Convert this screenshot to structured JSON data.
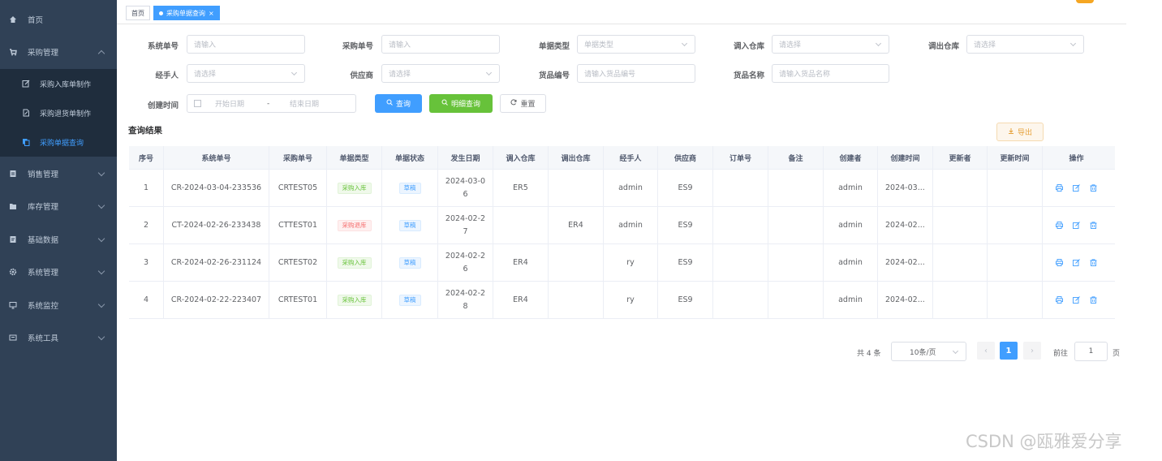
{
  "sidebar": {
    "items": [
      {
        "label": "首页",
        "icon": "dashboard-icon"
      },
      {
        "label": "采购管理",
        "icon": "cart-icon"
      },
      {
        "label": "销售管理",
        "icon": "document-icon"
      },
      {
        "label": "库存管理",
        "icon": "folder-icon"
      },
      {
        "label": "基础数据",
        "icon": "document-icon"
      },
      {
        "label": "系统管理",
        "icon": "gear-icon"
      },
      {
        "label": "系统监控",
        "icon": "monitor-icon"
      },
      {
        "label": "系统工具",
        "icon": "tool-icon"
      }
    ],
    "subitems": [
      {
        "label": "采购入库单制作",
        "icon": "edit-icon"
      },
      {
        "label": "采购退货单制作",
        "icon": "edit-doc-icon"
      },
      {
        "label": "采购单据查询",
        "icon": "copy-icon"
      }
    ]
  },
  "tags": {
    "home": "首页",
    "current": "采购单据查询"
  },
  "filters": {
    "system_no": {
      "label": "系统单号",
      "placeholder": "请输入"
    },
    "purchase_no": {
      "label": "采购单号",
      "placeholder": "请输入"
    },
    "doc_type": {
      "label": "单据类型",
      "placeholder": "单据类型"
    },
    "in_warehouse": {
      "label": "调入仓库",
      "placeholder": "请选择"
    },
    "out_warehouse": {
      "label": "调出仓库",
      "placeholder": "请选择"
    },
    "handler": {
      "label": "经手人",
      "placeholder": "请选择"
    },
    "supplier": {
      "label": "供应商",
      "placeholder": "请选择"
    },
    "goods_code": {
      "label": "货品编号",
      "placeholder": "请输入货品编号"
    },
    "goods_name": {
      "label": "货品名称",
      "placeholder": "请输入货品名称"
    },
    "created": {
      "label": "创建时间",
      "start": "开始日期",
      "sep": "-",
      "end": "结束日期"
    }
  },
  "buttons": {
    "search": "查询",
    "detail_search": "明细查询",
    "reset": "重置",
    "export": "导出"
  },
  "section_title": "查询结果",
  "table": {
    "headers": [
      "序号",
      "系统单号",
      "采购单号",
      "单据类型",
      "单据状态",
      "发生日期",
      "调入仓库",
      "调出仓库",
      "经手人",
      "供应商",
      "订单号",
      "备注",
      "创建者",
      "创建时间",
      "更新者",
      "更新时间",
      "操作"
    ],
    "rows": [
      {
        "idx": "1",
        "sys_no": "CR-2024-03-04-233536",
        "pur_no": "CRTEST05",
        "type": "采购入库",
        "type_color": "green",
        "status": "草稿",
        "date_a": "2024-03-0",
        "date_b": "6",
        "in_wh": "ER5",
        "out_wh": "",
        "handler": "admin",
        "supplier": "ES9",
        "order_no": "",
        "remark": "",
        "creator": "admin",
        "created": "2024-03...",
        "updater": "",
        "updated": ""
      },
      {
        "idx": "2",
        "sys_no": "CT-2024-02-26-233438",
        "pur_no": "CTTEST01",
        "type": "采购退库",
        "type_color": "red",
        "status": "草稿",
        "date_a": "2024-02-2",
        "date_b": "7",
        "in_wh": "",
        "out_wh": "ER4",
        "handler": "admin",
        "supplier": "ES9",
        "order_no": "",
        "remark": "",
        "creator": "admin",
        "created": "2024-02...",
        "updater": "",
        "updated": ""
      },
      {
        "idx": "3",
        "sys_no": "CR-2024-02-26-231124",
        "pur_no": "CRTEST02",
        "type": "采购入库",
        "type_color": "green",
        "status": "草稿",
        "date_a": "2024-02-2",
        "date_b": "6",
        "in_wh": "ER4",
        "out_wh": "",
        "handler": "ry",
        "supplier": "ES9",
        "order_no": "",
        "remark": "",
        "creator": "admin",
        "created": "2024-02...",
        "updater": "",
        "updated": ""
      },
      {
        "idx": "4",
        "sys_no": "CR-2024-02-22-223407",
        "pur_no": "CRTEST01",
        "type": "采购入库",
        "type_color": "green",
        "status": "草稿",
        "date_a": "2024-02-2",
        "date_b": "8",
        "in_wh": "ER4",
        "out_wh": "",
        "handler": "ry",
        "supplier": "ES9",
        "order_no": "",
        "remark": "",
        "creator": "admin",
        "created": "2024-02...",
        "updater": "",
        "updated": ""
      }
    ]
  },
  "pagination": {
    "total": "共 4 条",
    "page_size": "10条/页",
    "prev": "‹",
    "current": "1",
    "next": "›",
    "goto_label": "前往",
    "goto_value": "1",
    "page_unit": "页"
  },
  "watermark": "CSDN @瓯雅爱分享",
  "colors": {
    "sidebar_bg": "#304156",
    "primary": "#409eff",
    "success": "#67c23a",
    "danger": "#f56c6c",
    "warning": "#e6a23c"
  }
}
